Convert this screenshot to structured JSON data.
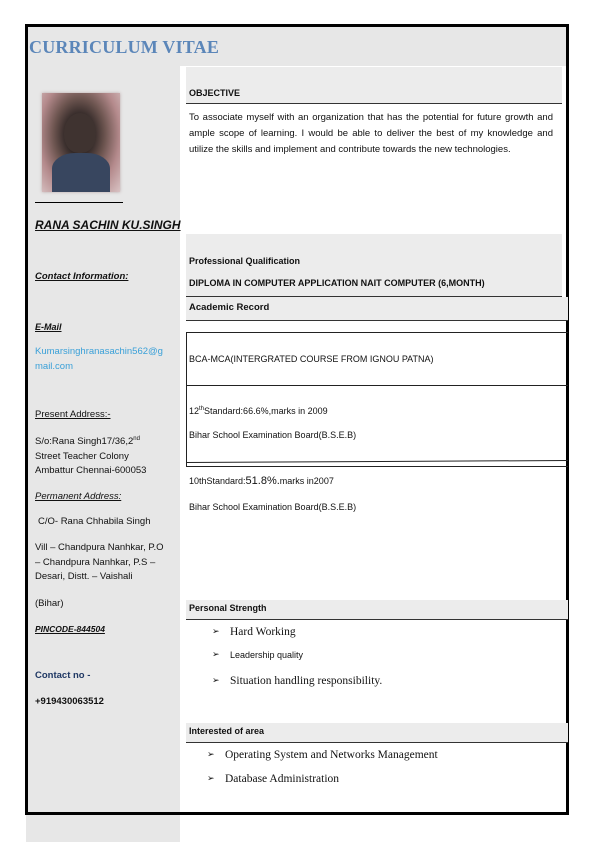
{
  "header": {
    "title": "CURRICULUM VITAE"
  },
  "sidebar": {
    "name": "RANA SACHIN KU.SINGH",
    "contact_heading": "Contact Information:",
    "email_label": "E-Mail",
    "email_line1": "Kumarsinghranasachin562@g",
    "email_line2": "mail.com",
    "present_address_label": "Present Address:-",
    "present_address_line1a": "S/o:Rana Singh17/36,2",
    "present_address_sup": "nd",
    "present_address_line2": "Street Teacher Colony",
    "present_address_line3": "Ambattur Chennai-600053",
    "permanent_address_label": "Permanent Address:",
    "permanent_co": "C/O- Rana Chhabila Singh",
    "permanent_line1": "Vill – Chandpura Nanhkar, P.O",
    "permanent_line2": "– Chandpura Nanhkar, P.S –",
    "permanent_line3": "Desari, Distt. – Vaishali",
    "state": "(Bihar)",
    "pincode": "PINCODE-844504",
    "contact_no_label": "Contact no -",
    "contact_no": "+919430063512"
  },
  "objective": {
    "heading": "OBJECTIVE",
    "text": "To associate myself with an organization that has the potential for future growth and ample scope of learning. I would be able to deliver the best of my knowledge and utilize the skills and implement and contribute towards the new technologies."
  },
  "qualification": {
    "heading": "Professional Qualification",
    "item": "DIPLOMA IN COMPUTER APPLICATION  NAIT COMPUTER (6,MONTH)"
  },
  "academic": {
    "heading": "Academic Record",
    "bca": "BCA-MCA(INTERGRATED COURSE FROM IGNOU PATNA)",
    "twelfth_a": "12",
    "twelfth_sup": "th",
    "twelfth_b": "Standard:66.6%,marks in 2009",
    "twelfth_board": "Bihar School Examination Board(B.S.E.B)",
    "tenth_a": "10thStandard:",
    "tenth_pct": "51.8%.",
    "tenth_b": "marks in2007",
    "tenth_board": "Bihar School Examination Board(B.S.E.B)"
  },
  "strengths": {
    "heading": "Personal Strength",
    "items": [
      "Hard Working",
      "Leadership quality",
      "Situation handling responsibility."
    ]
  },
  "interests": {
    "heading": "Interested of area",
    "items": [
      "Operating System and Networks Management",
      "Database Administration"
    ]
  },
  "icons": {
    "bullet": "➢"
  },
  "colors": {
    "title": "#5b86b9",
    "email": "#3aa0d8",
    "contact_label": "#1f3864",
    "sidebar_bg": "#e7e7e7"
  }
}
